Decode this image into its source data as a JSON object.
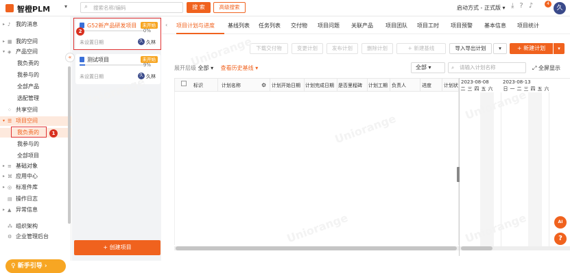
{
  "header": {
    "logo_text": "智橙PLM",
    "search_placeholder": "搜索名称/编码",
    "search_button": "搜 索",
    "advanced_search": "高级搜索",
    "start_mode": "启动方式 - 正式版 ▾",
    "notification_count": "4",
    "avatar_text": "久"
  },
  "nav": {
    "items": [
      {
        "label": "我的消息",
        "caret": "▸",
        "icon": "bell-icon"
      },
      {
        "label": "我的空间",
        "caret": "▸",
        "icon": "grid-icon"
      },
      {
        "label": "产品空间",
        "caret": "▾",
        "icon": "cube-icon"
      },
      {
        "label": "我负责的"
      },
      {
        "label": "我参与的"
      },
      {
        "label": "全部产品"
      },
      {
        "label": "选配管理"
      },
      {
        "label": "共享空间",
        "icon": "share-icon"
      },
      {
        "label": "项目空间",
        "caret": "▾",
        "icon": "project-icon"
      },
      {
        "label": "我负责的"
      },
      {
        "label": "我参与的"
      },
      {
        "label": "全部项目"
      },
      {
        "label": "基础对象",
        "caret": "▸",
        "icon": "database-icon"
      },
      {
        "label": "应用中心",
        "caret": "▸",
        "icon": "app-icon"
      },
      {
        "label": "标准件库",
        "caret": "▸",
        "icon": "library-icon"
      },
      {
        "label": "操作日志",
        "icon": "log-icon"
      },
      {
        "label": "异常信息",
        "caret": "▸",
        "icon": "warning-icon"
      },
      {
        "label": "组织架构",
        "icon": "org-icon"
      },
      {
        "label": "企业管理后台",
        "icon": "admin-icon"
      }
    ],
    "guide_button": "新手引导 ›",
    "marker_1": "1",
    "collapse_icon": "«"
  },
  "projects": {
    "cards": [
      {
        "name": "G52新产品研发项目",
        "status": "未开始",
        "percent": "0%",
        "progress": 0,
        "date": "未设置日期",
        "owner": "久林",
        "owner_avatar": "久"
      },
      {
        "name": "测试项目",
        "status": "未开始",
        "percent": "9%",
        "progress": 0.09,
        "date": "未设置日期",
        "owner": "久林",
        "owner_avatar": "久"
      }
    ],
    "marker_2": "2",
    "create_button": "+ 创建项目"
  },
  "main": {
    "tabs": [
      "项目计划与进度",
      "基线列表",
      "任务列表",
      "交付物",
      "项目问题",
      "关联产品",
      "项目团队",
      "项目工时",
      "项目预警",
      "基本信息",
      "项目统计"
    ],
    "toolbar": [
      "下载交付物",
      "变更计划",
      "发布计划",
      "删除计划",
      "+ 新建基线",
      "导入导出计划",
      "▾"
    ],
    "new_plan": "+ 新建计划",
    "new_plan_dd": "▾",
    "expand_level_label": "展开层级",
    "expand_level_value": "全部 ▾",
    "history_baseline": "查看历史基线 ▾",
    "filter_all": "全部 ▾",
    "plan_search_placeholder": "请输入计划名称",
    "fullscreen": "⤢ 全屏显示",
    "columns": [
      "标识",
      "计划名称",
      "⚙",
      "计划开始日期",
      "计划完成日期",
      "是否里程碑",
      "计划工期",
      "负责人",
      "进度",
      "计划状"
    ],
    "gantt": {
      "weeks": [
        "2023-08-08",
        "2023-08-13"
      ],
      "days": [
        "二",
        "三",
        "四",
        "五",
        "六",
        "日",
        "一",
        "二",
        "三",
        "四",
        "五",
        "六"
      ]
    },
    "fab_ai": "AI",
    "fab_help": "?",
    "watermark": "Uniorange"
  }
}
